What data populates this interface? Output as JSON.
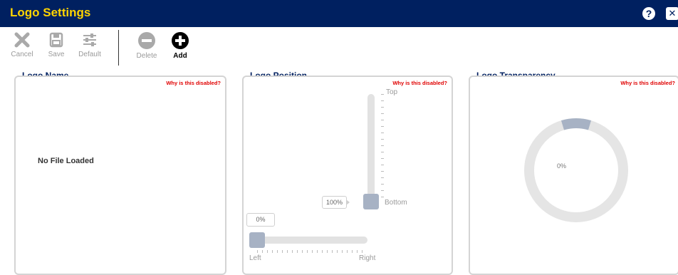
{
  "window": {
    "title": "Logo Settings"
  },
  "toolbar": {
    "cancel_label": "Cancel",
    "save_label": "Save",
    "default_label": "Default",
    "delete_label": "Delete",
    "add_label": "Add"
  },
  "panels": {
    "logo_name": {
      "title": "Logo Name",
      "why_disabled": "Why is this disabled?",
      "status": "No File Loaded"
    },
    "logo_position": {
      "title": "Logo Position",
      "why_disabled": "Why is this disabled?",
      "vertical": {
        "top_label": "Top",
        "bottom_label": "Bottom",
        "value": "100%"
      },
      "horizontal": {
        "left_label": "Left",
        "right_label": "Right",
        "value": "0%"
      }
    },
    "logo_transparency": {
      "title": "Logo Transparency",
      "why_disabled": "Why is this disabled?",
      "value": "0%"
    }
  },
  "colors": {
    "titlebar_bg": "#002060",
    "title_text": "#ffd400",
    "warning_text": "#e00000",
    "slider_thumb": "#a7b2c4",
    "slider_track": "#e2e2e2"
  },
  "icons": {
    "cancel": "close-x-icon",
    "save": "floppy-disk-icon",
    "default": "sliders-icon",
    "delete": "minus-circle-icon",
    "add": "plus-circle-icon",
    "help": "question-circle-icon",
    "close": "close-icon"
  }
}
